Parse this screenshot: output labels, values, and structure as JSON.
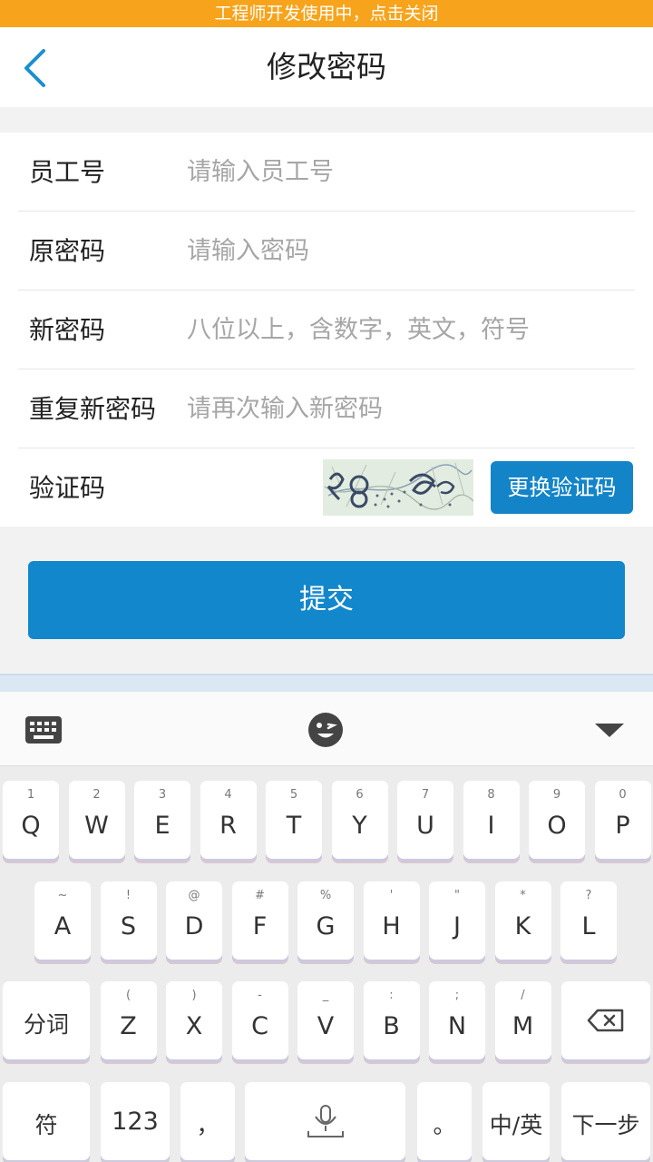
{
  "banner": {
    "text": "工程师开发使用中，点击关闭"
  },
  "header": {
    "title": "修改密码",
    "back_icon": "chevron-left-icon"
  },
  "form": {
    "employee_id": {
      "label": "员工号",
      "placeholder": "请输入员工号",
      "value": ""
    },
    "old_password": {
      "label": "原密码",
      "placeholder": "请输入密码",
      "value": ""
    },
    "new_password": {
      "label": "新密码",
      "placeholder": "八位以上，含数字，英文，符号",
      "value": ""
    },
    "repeat_password": {
      "label": "重复新密码",
      "placeholder": "请再次输入新密码",
      "value": ""
    },
    "captcha": {
      "label": "验证码",
      "refresh_label": "更换验证码"
    }
  },
  "submit": {
    "label": "提交"
  },
  "keyboard": {
    "toolbar": {
      "left_icon": "keyboard-icon",
      "center_icon": "emoji-icon",
      "right_icon": "triangle-down-icon"
    },
    "row1": [
      {
        "hint": "1",
        "main": "Q"
      },
      {
        "hint": "2",
        "main": "W"
      },
      {
        "hint": "3",
        "main": "E"
      },
      {
        "hint": "4",
        "main": "R"
      },
      {
        "hint": "5",
        "main": "T"
      },
      {
        "hint": "6",
        "main": "Y"
      },
      {
        "hint": "7",
        "main": "U"
      },
      {
        "hint": "8",
        "main": "I"
      },
      {
        "hint": "9",
        "main": "O"
      },
      {
        "hint": "0",
        "main": "P"
      }
    ],
    "row2": [
      {
        "hint": "~",
        "main": "A"
      },
      {
        "hint": "!",
        "main": "S"
      },
      {
        "hint": "@",
        "main": "D"
      },
      {
        "hint": "#",
        "main": "F"
      },
      {
        "hint": "%",
        "main": "G"
      },
      {
        "hint": "'",
        "main": "H"
      },
      {
        "hint": "\"",
        "main": "J"
      },
      {
        "hint": "*",
        "main": "K"
      },
      {
        "hint": "?",
        "main": "L"
      }
    ],
    "row3": [
      {
        "hint": "",
        "main": "分词"
      },
      {
        "hint": "(",
        "main": "Z"
      },
      {
        "hint": ")",
        "main": "X"
      },
      {
        "hint": "-",
        "main": "C"
      },
      {
        "hint": "_",
        "main": "V"
      },
      {
        "hint": ":",
        "main": "B"
      },
      {
        "hint": ";",
        "main": "N"
      },
      {
        "hint": "/",
        "main": "M"
      }
    ],
    "row4": {
      "symbol": "符",
      "num": "123",
      "comma": "，",
      "period": "。",
      "lang": "中/英",
      "next": "下一步"
    },
    "backspace_icon": "backspace-icon",
    "mic_icon": "microphone-icon"
  }
}
